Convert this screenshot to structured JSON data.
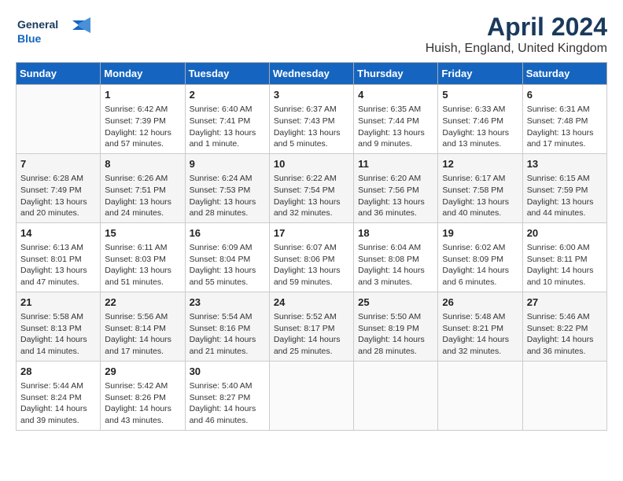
{
  "logo": {
    "line1": "General",
    "line2": "Blue"
  },
  "title": "April 2024",
  "subtitle": "Huish, England, United Kingdom",
  "days_header": [
    "Sunday",
    "Monday",
    "Tuesday",
    "Wednesday",
    "Thursday",
    "Friday",
    "Saturday"
  ],
  "weeks": [
    [
      {
        "day": "",
        "info": ""
      },
      {
        "day": "1",
        "info": "Sunrise: 6:42 AM\nSunset: 7:39 PM\nDaylight: 12 hours\nand 57 minutes."
      },
      {
        "day": "2",
        "info": "Sunrise: 6:40 AM\nSunset: 7:41 PM\nDaylight: 13 hours\nand 1 minute."
      },
      {
        "day": "3",
        "info": "Sunrise: 6:37 AM\nSunset: 7:43 PM\nDaylight: 13 hours\nand 5 minutes."
      },
      {
        "day": "4",
        "info": "Sunrise: 6:35 AM\nSunset: 7:44 PM\nDaylight: 13 hours\nand 9 minutes."
      },
      {
        "day": "5",
        "info": "Sunrise: 6:33 AM\nSunset: 7:46 PM\nDaylight: 13 hours\nand 13 minutes."
      },
      {
        "day": "6",
        "info": "Sunrise: 6:31 AM\nSunset: 7:48 PM\nDaylight: 13 hours\nand 17 minutes."
      }
    ],
    [
      {
        "day": "7",
        "info": "Sunrise: 6:28 AM\nSunset: 7:49 PM\nDaylight: 13 hours\nand 20 minutes."
      },
      {
        "day": "8",
        "info": "Sunrise: 6:26 AM\nSunset: 7:51 PM\nDaylight: 13 hours\nand 24 minutes."
      },
      {
        "day": "9",
        "info": "Sunrise: 6:24 AM\nSunset: 7:53 PM\nDaylight: 13 hours\nand 28 minutes."
      },
      {
        "day": "10",
        "info": "Sunrise: 6:22 AM\nSunset: 7:54 PM\nDaylight: 13 hours\nand 32 minutes."
      },
      {
        "day": "11",
        "info": "Sunrise: 6:20 AM\nSunset: 7:56 PM\nDaylight: 13 hours\nand 36 minutes."
      },
      {
        "day": "12",
        "info": "Sunrise: 6:17 AM\nSunset: 7:58 PM\nDaylight: 13 hours\nand 40 minutes."
      },
      {
        "day": "13",
        "info": "Sunrise: 6:15 AM\nSunset: 7:59 PM\nDaylight: 13 hours\nand 44 minutes."
      }
    ],
    [
      {
        "day": "14",
        "info": "Sunrise: 6:13 AM\nSunset: 8:01 PM\nDaylight: 13 hours\nand 47 minutes."
      },
      {
        "day": "15",
        "info": "Sunrise: 6:11 AM\nSunset: 8:03 PM\nDaylight: 13 hours\nand 51 minutes."
      },
      {
        "day": "16",
        "info": "Sunrise: 6:09 AM\nSunset: 8:04 PM\nDaylight: 13 hours\nand 55 minutes."
      },
      {
        "day": "17",
        "info": "Sunrise: 6:07 AM\nSunset: 8:06 PM\nDaylight: 13 hours\nand 59 minutes."
      },
      {
        "day": "18",
        "info": "Sunrise: 6:04 AM\nSunset: 8:08 PM\nDaylight: 14 hours\nand 3 minutes."
      },
      {
        "day": "19",
        "info": "Sunrise: 6:02 AM\nSunset: 8:09 PM\nDaylight: 14 hours\nand 6 minutes."
      },
      {
        "day": "20",
        "info": "Sunrise: 6:00 AM\nSunset: 8:11 PM\nDaylight: 14 hours\nand 10 minutes."
      }
    ],
    [
      {
        "day": "21",
        "info": "Sunrise: 5:58 AM\nSunset: 8:13 PM\nDaylight: 14 hours\nand 14 minutes."
      },
      {
        "day": "22",
        "info": "Sunrise: 5:56 AM\nSunset: 8:14 PM\nDaylight: 14 hours\nand 17 minutes."
      },
      {
        "day": "23",
        "info": "Sunrise: 5:54 AM\nSunset: 8:16 PM\nDaylight: 14 hours\nand 21 minutes."
      },
      {
        "day": "24",
        "info": "Sunrise: 5:52 AM\nSunset: 8:17 PM\nDaylight: 14 hours\nand 25 minutes."
      },
      {
        "day": "25",
        "info": "Sunrise: 5:50 AM\nSunset: 8:19 PM\nDaylight: 14 hours\nand 28 minutes."
      },
      {
        "day": "26",
        "info": "Sunrise: 5:48 AM\nSunset: 8:21 PM\nDaylight: 14 hours\nand 32 minutes."
      },
      {
        "day": "27",
        "info": "Sunrise: 5:46 AM\nSunset: 8:22 PM\nDaylight: 14 hours\nand 36 minutes."
      }
    ],
    [
      {
        "day": "28",
        "info": "Sunrise: 5:44 AM\nSunset: 8:24 PM\nDaylight: 14 hours\nand 39 minutes."
      },
      {
        "day": "29",
        "info": "Sunrise: 5:42 AM\nSunset: 8:26 PM\nDaylight: 14 hours\nand 43 minutes."
      },
      {
        "day": "30",
        "info": "Sunrise: 5:40 AM\nSunset: 8:27 PM\nDaylight: 14 hours\nand 46 minutes."
      },
      {
        "day": "",
        "info": ""
      },
      {
        "day": "",
        "info": ""
      },
      {
        "day": "",
        "info": ""
      },
      {
        "day": "",
        "info": ""
      }
    ]
  ]
}
